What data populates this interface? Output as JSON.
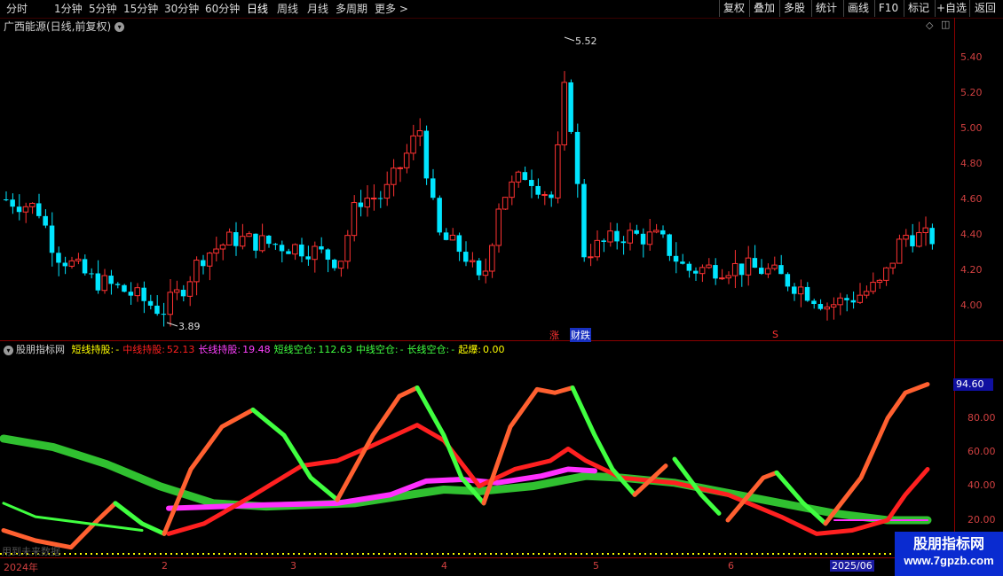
{
  "toolbar": {
    "timeframes": [
      "分时",
      "1分钟",
      "5分钟",
      "15分钟",
      "30分钟",
      "60分钟",
      "日线",
      "周线",
      "月线",
      "多周期",
      "更多 >"
    ],
    "active_timeframe": "日线",
    "buttons": [
      "复权",
      "叠加",
      "多股",
      "统计",
      "画线",
      "F10",
      "标记",
      "+自选",
      "返回"
    ]
  },
  "main_chart": {
    "title": "广西能源(日线,前复权)",
    "price_axis": [
      "5.40",
      "5.20",
      "5.00",
      "4.80",
      "4.60",
      "4.40",
      "4.20",
      "4.00"
    ],
    "high_label": "5.52",
    "low_label": "3.89",
    "marks": {
      "zhang": "涨",
      "caidie": "财跌",
      "s": "S"
    }
  },
  "indicator": {
    "name": "股朋指标网",
    "fields": [
      {
        "label": "短线持股:",
        "value": "-",
        "color": "#ffff00"
      },
      {
        "label": "中线持股:",
        "value": "52.13",
        "color": "#ff2020"
      },
      {
        "label": "长线持股:",
        "value": "19.48",
        "color": "#ff40ff"
      },
      {
        "label": "短线空仓:",
        "value": "112.63",
        "color": "#40ff40"
      },
      {
        "label": "中线空仓:",
        "value": "-",
        "color": "#40ff40"
      },
      {
        "label": "长线空仓:",
        "value": "-",
        "color": "#40ff40"
      },
      {
        "label": "起爆:",
        "value": "0.00",
        "color": "#ffff00"
      }
    ],
    "axis": [
      "80.00",
      "60.00",
      "40.00",
      "20.00"
    ],
    "current_value": "94.60",
    "faint_text": "用到未来数据"
  },
  "dates": {
    "labels": [
      "2024年",
      "2",
      "3",
      "4",
      "5",
      "6"
    ],
    "highlight": "2025/06"
  },
  "watermark": {
    "line1": "股朋指标网",
    "line2": "www.7gpzb.com"
  },
  "colors": {
    "up": "#ff3232",
    "down": "#00e5ff",
    "axis": "#d04040",
    "grid": "#8b0000"
  }
}
